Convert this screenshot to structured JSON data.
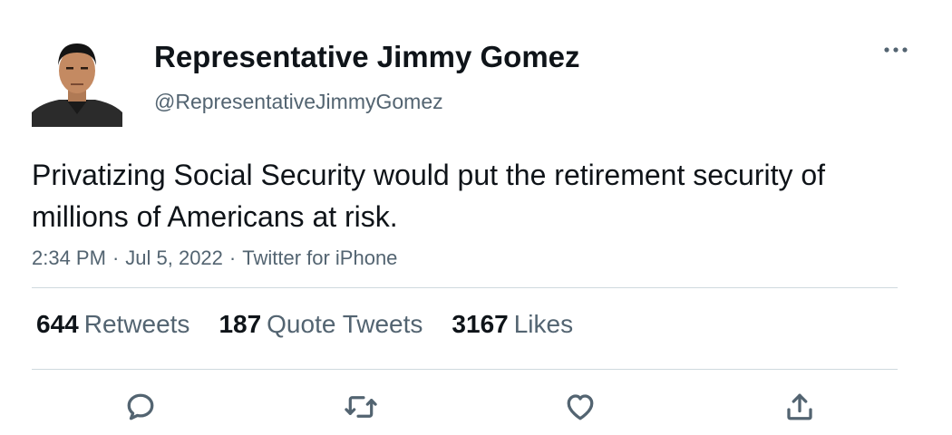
{
  "tweet": {
    "author": {
      "display_name": "Representative Jimmy Gomez",
      "handle": "@RepresentativeJimmyGomez"
    },
    "text": "Privatizing Social Security would put the retirement security of millions of Americans at risk.",
    "time": "2:34 PM",
    "date": "Jul 5, 2022",
    "source": "Twitter for iPhone",
    "separator": "·",
    "stats": {
      "retweets_count": "644",
      "retweets_label": "Retweets",
      "quotes_count": "187",
      "quotes_label": "Quote Tweets",
      "likes_count": "3167",
      "likes_label": "Likes"
    },
    "actions": {
      "reply_icon": "reply-icon",
      "retweet_icon": "retweet-icon",
      "like_icon": "like-icon",
      "share_icon": "share-icon"
    },
    "colors": {
      "text": "#0f1419",
      "secondary": "#536471",
      "divider": "#cfd9de"
    }
  }
}
